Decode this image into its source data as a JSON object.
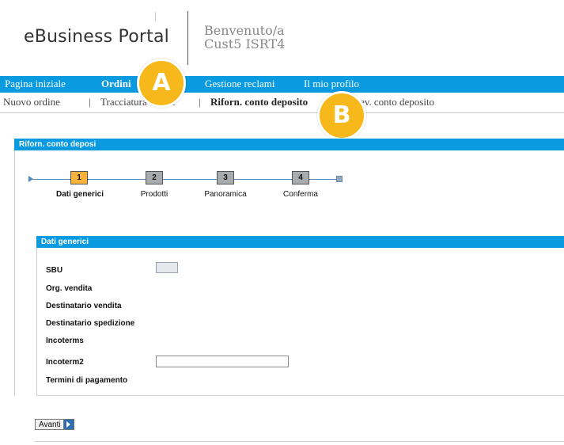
{
  "header": {
    "brand": "eBusiness Portal",
    "welcome_line1": "Benvenuto/a",
    "welcome_line2": "Cust5 ISRT4"
  },
  "main_nav": {
    "items": [
      {
        "label": "Pagina iniziale",
        "active": false
      },
      {
        "label": "Ordini",
        "active": true
      },
      {
        "label": "Gestione reclami",
        "active": false
      },
      {
        "label": "Il mio profilo",
        "active": false
      }
    ]
  },
  "sub_nav": {
    "items": [
      {
        "label": "Nuovo ordine",
        "active": false
      },
      {
        "label": "Tracciatura ordine",
        "active": false
      },
      {
        "label": "Riforn. conto deposito",
        "active": true
      },
      {
        "label": "Prelev. conto deposito",
        "active": false
      }
    ],
    "separator": "|"
  },
  "markers": {
    "a": "A",
    "b": "B"
  },
  "panel": {
    "title": "Riforn. conto deposi"
  },
  "wizard": {
    "steps": [
      {
        "number": "1",
        "label": "Dati generici",
        "active": true
      },
      {
        "number": "2",
        "label": "Prodotti",
        "active": false
      },
      {
        "number": "3",
        "label": "Panoramica",
        "active": false
      },
      {
        "number": "4",
        "label": "Conferma",
        "active": false
      }
    ]
  },
  "form": {
    "title": "Dati generici",
    "fields": {
      "sbu": {
        "label": "SBU",
        "value": ""
      },
      "org_vendita": {
        "label": "Org. vendita"
      },
      "destinatario_vendita": {
        "label": "Destinatario vendita"
      },
      "destinatario_spedizione": {
        "label": "Destinatario spedizione"
      },
      "incoterms": {
        "label": "Incoterms"
      },
      "incoterm2": {
        "label": "Incoterm2",
        "value": ""
      },
      "termini_pagamento": {
        "label": "Termini di pagamento"
      }
    }
  },
  "buttons": {
    "next": "Avanti"
  },
  "colors": {
    "nav_blue": "#0a9ae0",
    "marker_yellow": "#f7b81c",
    "step_active": "#f7b33b",
    "step_inactive": "#a7abae"
  }
}
